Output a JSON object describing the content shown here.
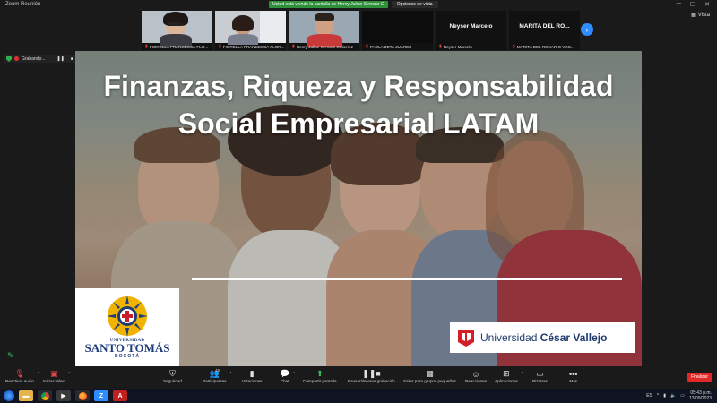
{
  "window": {
    "title": "Zoom Reunión"
  },
  "share_banner": {
    "message": "Usted está viendo la pantalla de Henry Julian Serrano G",
    "options_label": "Opciones de vista"
  },
  "view_button": {
    "label": "Vista"
  },
  "participants": [
    {
      "name": "FIORELLA FRANCESCA FLO...",
      "video": true
    },
    {
      "name": "FIORELLA FRANCESCA FLOR...",
      "video": true
    },
    {
      "name": "Henry Julian Serrano Gutierrez",
      "video": true
    },
    {
      "name": "PAOLA ZETA JUAREZ",
      "video": false
    },
    {
      "name": "Neyser Marcelo",
      "display_name": "Neyser Marcelo",
      "video": false
    },
    {
      "name": "MARITA DEL ROSARIO VEG...",
      "display_name": "MARITA DEL RO...",
      "video": false
    }
  ],
  "recording": {
    "label": "Grabando..."
  },
  "slide": {
    "title_line1": "Finanzas, Riqueza y Responsabilidad",
    "title_line2": "Social Empresarial LATAM",
    "logo_left": {
      "univ": "UNIVERSIDAD",
      "name": "SANTO TOMÁS",
      "city": "BOGOTÁ"
    },
    "logo_right": {
      "prefix": "Universidad ",
      "bold": "César Vallejo"
    }
  },
  "toolbar": {
    "audio": "Reactivar audio",
    "video": "Iniciar video",
    "security": "Seguridad",
    "participants": "Participantes",
    "participants_count": "49",
    "polls": "Votaciones",
    "chat": "Chat",
    "share": "Compartir pantalla",
    "record": "Pausar/detener grabación",
    "rooms": "Salas para grupos pequeños",
    "reactions": "Reacciones",
    "apps": "Aplicaciones",
    "whiteboards": "Pizarras",
    "more": "Más",
    "end": "Finalizar"
  },
  "taskbar": {
    "lang": "ES",
    "time": "05:43 p.m.",
    "date": "13/09/2023"
  },
  "colors": {
    "zoom_blue": "#2d8cff",
    "share_green": "#2f8f3a",
    "end_red": "#e02828",
    "ucv_red": "#d41f26"
  }
}
